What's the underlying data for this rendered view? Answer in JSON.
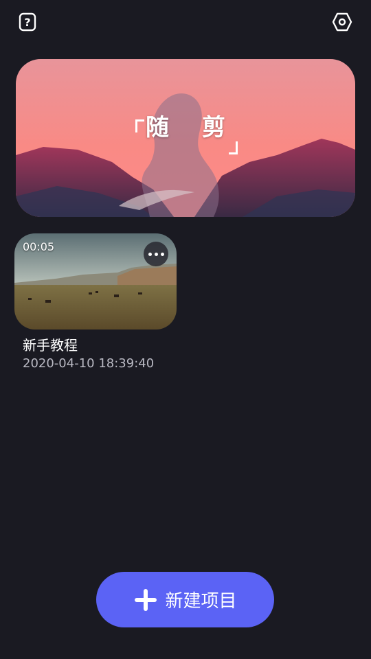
{
  "top_bar": {
    "help_icon": "help-icon",
    "settings_icon": "hexagon-settings-icon"
  },
  "banner": {
    "title": "随剪"
  },
  "projects": [
    {
      "duration": "00:05",
      "name": "新手教程",
      "date": "2020-04-10 18:39:40",
      "more_icon": "more-icon"
    }
  ],
  "new_project": {
    "label": "新建项目",
    "icon": "plus-icon"
  },
  "colors": {
    "background": "#1a1a22",
    "accent": "#5b63f5"
  }
}
